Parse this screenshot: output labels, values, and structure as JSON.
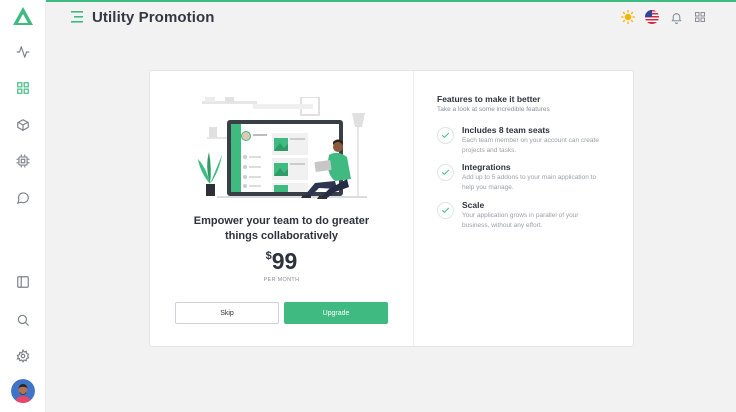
{
  "colors": {
    "accent": "#3fba80",
    "background": "#f2f2f3",
    "text": "#2d333d",
    "muted": "#8a8f99"
  },
  "header": {
    "title": "Utility Promotion"
  },
  "sidebar": {
    "icons": [
      "activity-icon",
      "grid-icon",
      "box-icon",
      "cpu-icon",
      "message-circle-icon",
      "sidebar-panel-icon",
      "search-icon",
      "settings-icon"
    ],
    "active": "grid-icon"
  },
  "header_icons": [
    "sun-icon",
    "us-flag-icon",
    "bell-icon",
    "apps-grid-icon"
  ],
  "promo": {
    "headline_line1": "Empower your team to do greater",
    "headline_line2": "things collaboratively",
    "currency": "$",
    "price": "99",
    "period": "PER MONTH",
    "skip_label": "Skip",
    "upgrade_label": "Upgrade"
  },
  "features": {
    "title": "Features to make it better",
    "subtitle": "Take a look at some incredible features",
    "items": [
      {
        "name": "Includes 8 team seats",
        "desc": "Each team member on your account can create projects and tasks."
      },
      {
        "name": "Integrations",
        "desc": "Add up to 5 addons to your main application to help you manage."
      },
      {
        "name": "Scale",
        "desc": "Your application grows in parallel of your business, without any effort."
      }
    ]
  }
}
